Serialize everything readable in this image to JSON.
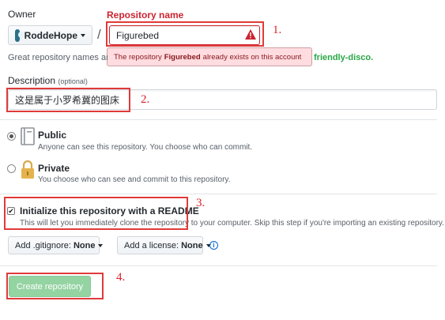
{
  "owner": {
    "label": "Owner",
    "name": "RoddeHope"
  },
  "separator": "/",
  "repo": {
    "label": "Repository name",
    "value": "Figurebed",
    "error_prefix": "The repository ",
    "error_name": "Figurebed",
    "error_suffix": " already exists on this account"
  },
  "hint": {
    "text": "Great repository names are",
    "suggestion": "friendly-disco."
  },
  "description": {
    "label": "Description",
    "optional": "(optional)",
    "value": "这是属于小罗希冀的图床"
  },
  "visibility": {
    "public": {
      "title": "Public",
      "desc": "Anyone can see this repository. You choose who can commit.",
      "selected": true
    },
    "private": {
      "title": "Private",
      "desc": "You choose who can see and commit to this repository.",
      "selected": false
    }
  },
  "readme": {
    "checked": true,
    "checkmark": "✔",
    "title": "Initialize this repository with a README",
    "desc": "This will let you immediately clone the repository to your computer. Skip this step if you're importing an existing repository."
  },
  "gitignore": {
    "label": "Add .gitignore:",
    "value": "None"
  },
  "license": {
    "label": "Add a license:",
    "value": "None"
  },
  "info_icon": "i",
  "create_button": "Create repository",
  "annotations": [
    "1.",
    "2.",
    "3.",
    "4."
  ],
  "colors": {
    "error_red": "#cb2431",
    "annotation_red": "#e03a3a",
    "create_green": "#94d3a2",
    "suggestion_green": "#28a745"
  }
}
